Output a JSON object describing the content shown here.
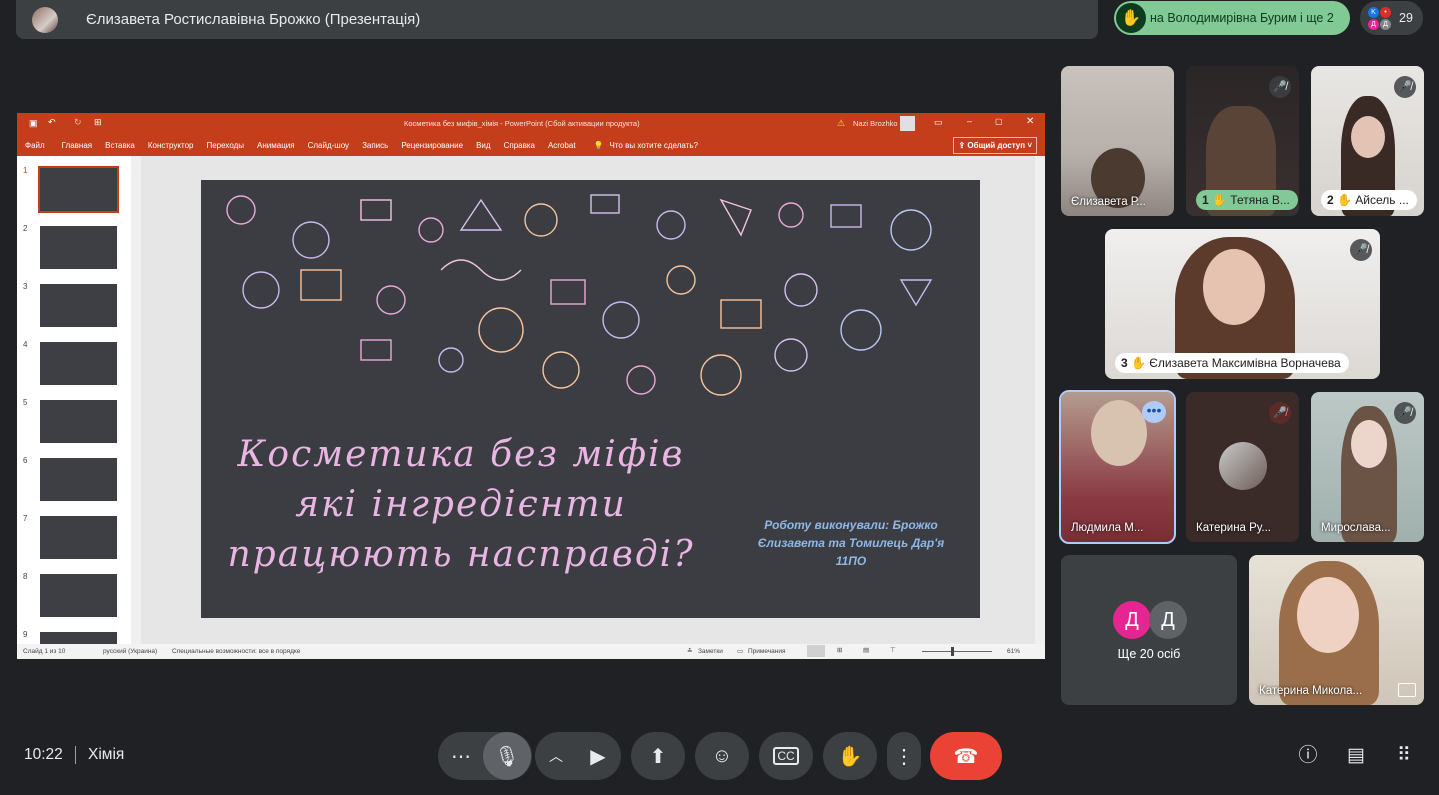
{
  "presenter": {
    "name": "Єлизавета Ростиславівна Брожко (Презентація)"
  },
  "hand_raise": {
    "text": "на Володимирівна Бурим і ще 2"
  },
  "people": {
    "count": "29",
    "mini_avatars": [
      "K",
      "•",
      "Д",
      "Д"
    ]
  },
  "ppt": {
    "window_title": "Косметика без мифів_хімія  -  PowerPoint (Сбой активации продукта)",
    "user": "Nazi Brozhko",
    "menu": [
      "Файл",
      "Главная",
      "Вставка",
      "Конструктор",
      "Переходы",
      "Анимация",
      "Слайд-шоу",
      "Запись",
      "Рецензирование",
      "Вид",
      "Справка",
      "Acrobat"
    ],
    "tell_me": "Что вы хотите сделать?",
    "share": "Общий доступ",
    "thumb_numbers": [
      "1",
      "2",
      "3",
      "4",
      "5",
      "6",
      "7",
      "8",
      "9"
    ],
    "slide_title_lines": [
      "Косметика без міфів",
      "які інгредієнти",
      "працюють насправді?"
    ],
    "slide_authors": [
      "Роботу виконували: Брожко",
      "Єлизавета та Томилець Дар'я",
      "11ПО"
    ],
    "status": {
      "slide_of": "Слайд 1 из 10",
      "language": "русский (Украина)",
      "accessibility": "Специальные возможности: все в порядке",
      "notes": "Заметки",
      "comments": "Примечания",
      "zoom": "61%"
    }
  },
  "tiles": [
    {
      "name": "Єлизавета Р...",
      "muted": false
    },
    {
      "name": "Тетяна В...",
      "hand": "1",
      "muted": true
    },
    {
      "name": "Айсель ...",
      "hand": "2",
      "muted": true
    },
    {
      "name": "Єлизавета Максимівна Ворначева",
      "hand": "3",
      "muted": true
    },
    {
      "name": "Людмила М...",
      "muted": false
    },
    {
      "name": "Катерина Ру...",
      "muted": true
    },
    {
      "name": "Мирослава...",
      "muted": true
    },
    {
      "name": "Катерина Микола...",
      "muted": false
    }
  ],
  "others": {
    "label": "Ще 20 осіб",
    "avatars": [
      "Д",
      "Д"
    ]
  },
  "bottom": {
    "time": "10:22",
    "meeting": "Хімія"
  }
}
